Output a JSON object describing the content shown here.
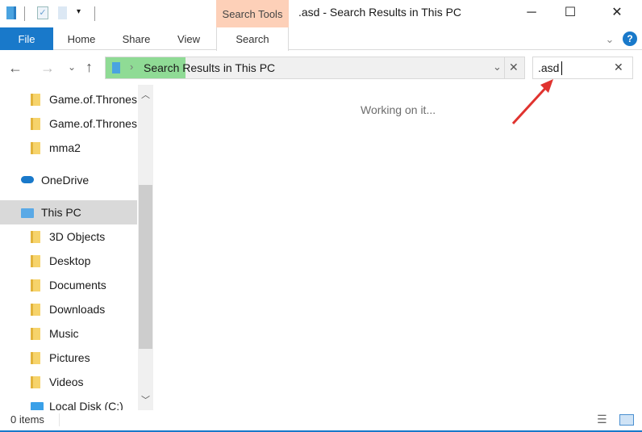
{
  "window": {
    "title": ".asd - Search Results in This PC",
    "context_tab_group": "Search Tools"
  },
  "ribbon": {
    "tabs": [
      "File",
      "Home",
      "Share",
      "View",
      "Search"
    ]
  },
  "address": {
    "path": "Search Results in This PC",
    "progress_percent": 19
  },
  "search": {
    "value": ".asd"
  },
  "main": {
    "status_message": "Working on it..."
  },
  "nav": {
    "items": [
      {
        "label": "Game.of.Thrones",
        "icon": "folder-icon"
      },
      {
        "label": "Game.of.Thrones",
        "icon": "folder-icon"
      },
      {
        "label": "mma2",
        "icon": "folder-icon"
      },
      {
        "label": "OneDrive",
        "icon": "cloud-icon"
      },
      {
        "label": "This PC",
        "icon": "computer-icon",
        "selected": true
      },
      {
        "label": "3D Objects",
        "icon": "3d-objects-icon"
      },
      {
        "label": "Desktop",
        "icon": "desktop-icon"
      },
      {
        "label": "Documents",
        "icon": "documents-icon"
      },
      {
        "label": "Downloads",
        "icon": "downloads-icon"
      },
      {
        "label": "Music",
        "icon": "music-icon"
      },
      {
        "label": "Pictures",
        "icon": "pictures-icon"
      },
      {
        "label": "Videos",
        "icon": "videos-icon"
      },
      {
        "label": "Local Disk (C:)",
        "icon": "drive-icon"
      }
    ]
  },
  "statusbar": {
    "items": "0 items"
  },
  "colors": {
    "accent": "#1979ca",
    "search_tools": "#fdd0b8",
    "progress": "#8fdb95",
    "arrow": "#e0332f"
  }
}
